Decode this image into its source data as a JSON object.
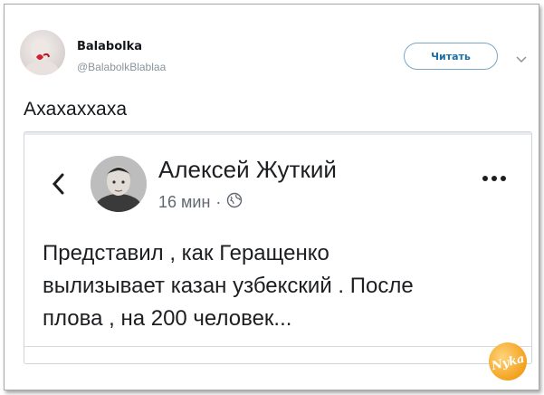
{
  "tweet": {
    "author_name": "Balabolka",
    "author_handle": "@BalabolkBlablaa",
    "follow_label": "Читать",
    "text": "Ахахаххаха"
  },
  "embed": {
    "author_name": "Алексей Жуткий",
    "time": "16 мин",
    "separator": "·",
    "post_lines": [
      "Представил , как Геращенко",
      "вылизывает казан узбекский . После",
      "плова , на 200 человек..."
    ]
  },
  "watermark": {
    "text": "Nyka"
  }
}
